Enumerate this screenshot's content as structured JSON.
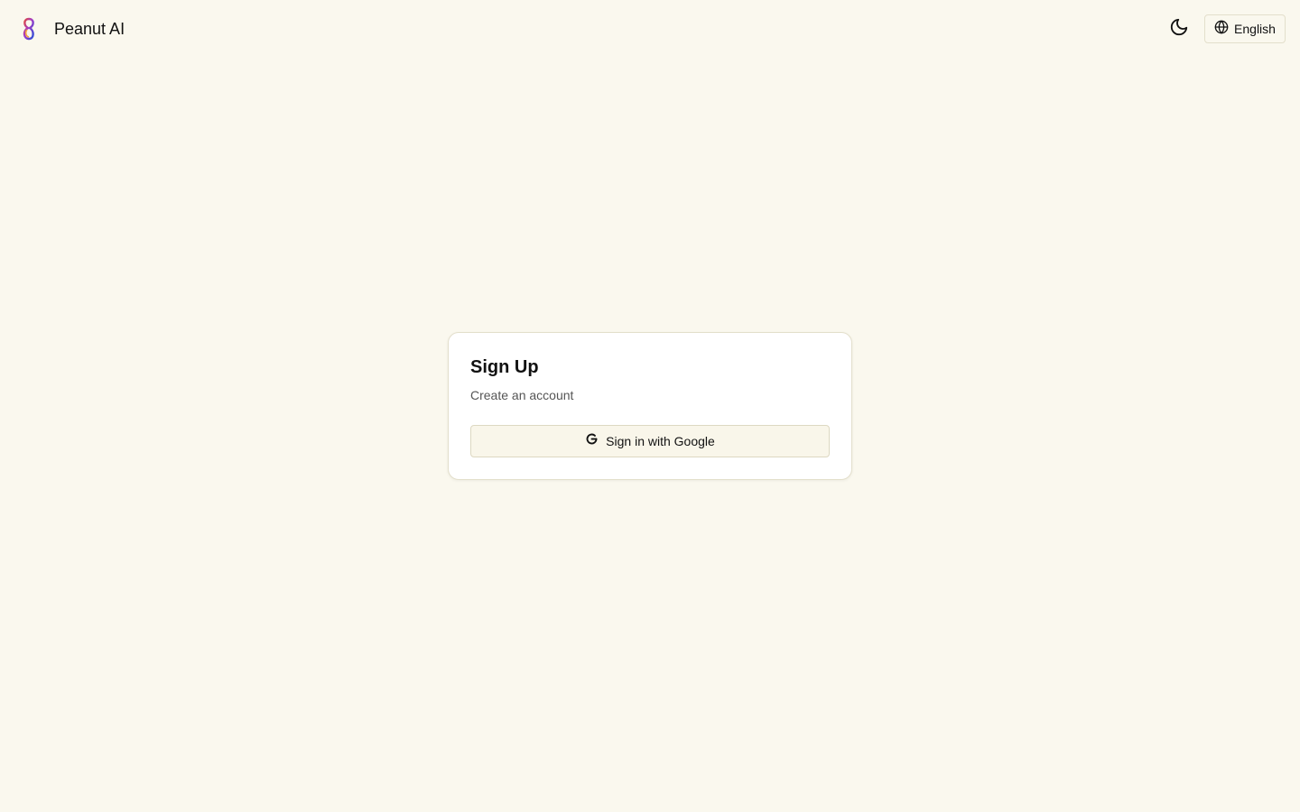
{
  "header": {
    "app_name": "Peanut AI",
    "logo_icon": "peanut-logo-icon",
    "theme_toggle_icon": "moon-icon",
    "language": {
      "icon": "globe-icon",
      "label": "English"
    }
  },
  "signup": {
    "title": "Sign Up",
    "subtitle": "Create an account",
    "google_button": {
      "icon": "google-icon",
      "label": "Sign in with Google"
    }
  },
  "colors": {
    "background": "#faf8ee",
    "card": "#ffffff",
    "border": "#e3dfcb",
    "text": "#111111",
    "muted_text": "#555555"
  }
}
